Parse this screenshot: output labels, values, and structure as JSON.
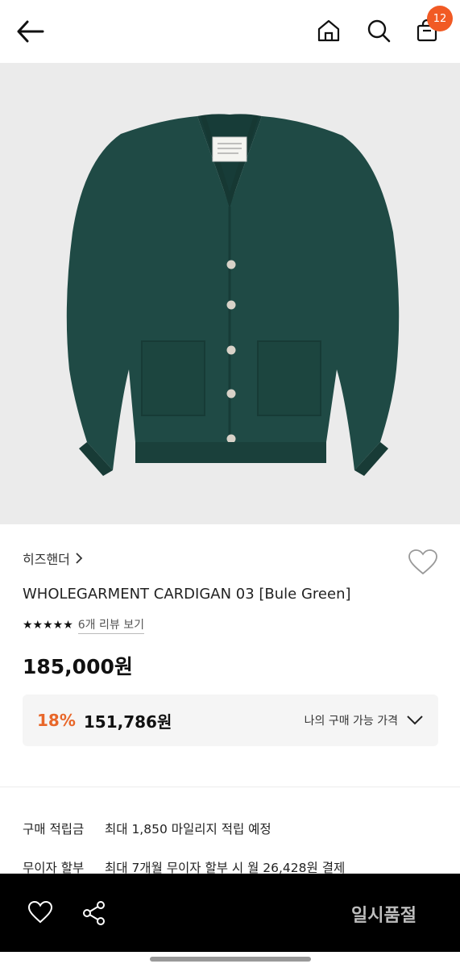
{
  "header": {
    "cart_count": "12",
    "icons": [
      "back-arrow-icon",
      "home-icon",
      "search-icon",
      "shopping-bag-icon"
    ]
  },
  "product": {
    "brand": "히즈핸더",
    "name": "WHOLEGARMENT CARDIGAN 03 [Bule Green]",
    "stars": "★★★★★",
    "review_link": "6개 리뷰 보기",
    "price": "185,000원",
    "discount_rate": "18%",
    "discount_price": "151,786원",
    "discount_note": "나의 구매 가능 가격",
    "main_color": "#1f4a45"
  },
  "benefits": [
    {
      "label": "구매 적립금",
      "value": "최대 1,850 마일리지 적립 예정"
    },
    {
      "label": "무이자 할부",
      "value": "최대 7개월 무이자 할부 시 월 26,428원 결제"
    }
  ],
  "bottom_bar": {
    "status_label": "일시품절"
  },
  "colors": {
    "accent_orange": "#e8672a",
    "badge": "#f15a24",
    "bottom_bar": "#000000"
  }
}
